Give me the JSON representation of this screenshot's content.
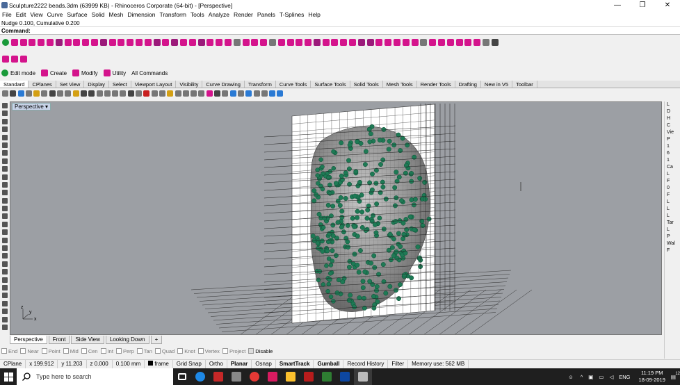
{
  "window": {
    "title": "Sculpture2222  beads.3dm (63999 KB) - Rhinoceros Corporate (64-bit) - [Perspective]",
    "controls": [
      "—",
      "❐",
      "✕"
    ]
  },
  "menu": [
    "File",
    "Edit",
    "View",
    "Curve",
    "Surface",
    "Solid",
    "Mesh",
    "Dimension",
    "Transform",
    "Tools",
    "Analyze",
    "Render",
    "Panels",
    "T-Splines",
    "Help"
  ],
  "command_history": "Nudge 0.100, Cumulative 0.200",
  "command_prompt": "Command:",
  "workflow_buttons": [
    "Edit mode",
    "Create",
    "Modify",
    "Utility",
    "All Commands"
  ],
  "toolbar_tabs": [
    "Standard",
    "CPlanes",
    "Set View",
    "Display",
    "Select",
    "Viewport Layout",
    "Visibility",
    "Curve Drawing",
    "Transform",
    "Curve Tools",
    "Surface Tools",
    "Solid Tools",
    "Mesh Tools",
    "Render Tools",
    "Drafting",
    "New in V5",
    "Toolbar"
  ],
  "active_toolbar_tab": "Standard",
  "viewport": {
    "label": "Perspective",
    "axis_x": "x",
    "axis_y": "y",
    "axis_z": "z"
  },
  "right_panel": [
    "L",
    "D",
    "H",
    "C",
    "Vie",
    "P",
    "1",
    "6",
    "1",
    "Ca",
    "L",
    "F",
    "0",
    "F",
    "L",
    "L",
    "L",
    "Tar",
    "L",
    "P",
    "Wal",
    "F"
  ],
  "viewport_tabs": [
    "Perspective",
    "Front",
    "Side View",
    "Looking Down",
    "+"
  ],
  "active_viewport_tab": "Perspective",
  "osnaps": [
    "End",
    "Near",
    "Point",
    "Mid",
    "Cen",
    "Int",
    "Perp",
    "Tan",
    "Quad",
    "Knot",
    "Vertex",
    "Project",
    "Disable"
  ],
  "status": {
    "cplane": "CPlane",
    "x": "x 199.912",
    "y": "y 11.203",
    "z": "z 0.000",
    "units": "0.100 mm",
    "layer": "frame",
    "toggles": [
      "Grid Snap",
      "Ortho",
      "Planar",
      "Osnap",
      "SmartTrack",
      "Gumball",
      "Record History",
      "Filter"
    ],
    "bold_toggles": [
      "Planar",
      "SmartTrack",
      "Gumball"
    ],
    "memory": "Memory use: 562 MB"
  },
  "taskbar": {
    "search_placeholder": "Type here to search",
    "language": "ENG",
    "time": "11:19 PM",
    "date": "18-09-2019",
    "notifications": "12"
  }
}
